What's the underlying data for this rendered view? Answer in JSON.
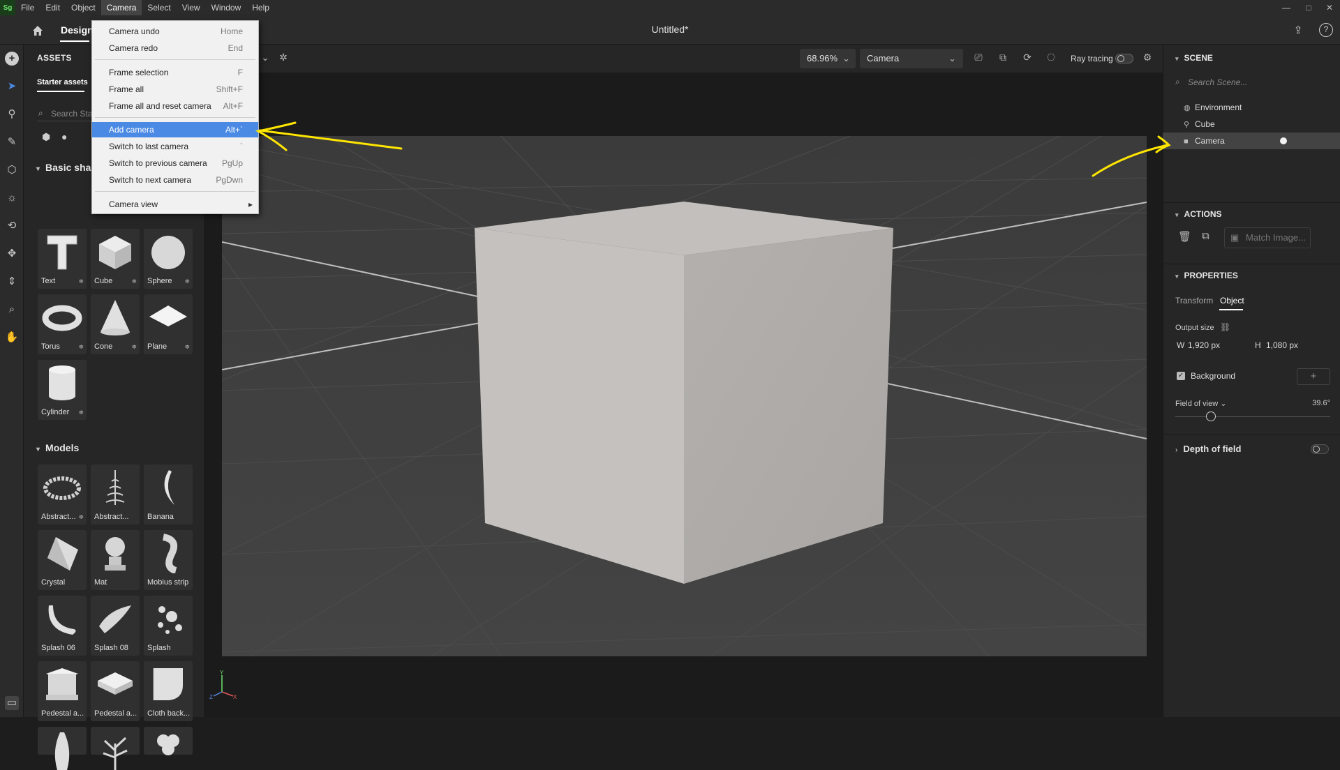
{
  "menubar": {
    "logo": "Sg",
    "items": [
      "File",
      "Edit",
      "Object",
      "Camera",
      "Select",
      "View",
      "Window",
      "Help"
    ],
    "active": "Camera"
  },
  "header": {
    "tab_design": "Design",
    "doc_title": "Untitled*"
  },
  "assets": {
    "title": "ASSETS",
    "tab": "Starter assets",
    "search_placeholder": "Search Starter assets",
    "sections": {
      "basic": "Basic shapes",
      "models": "Models"
    },
    "basic_shapes": [
      "Text",
      "Cube",
      "Sphere",
      "Torus",
      "Cone",
      "Plane",
      "Cylinder"
    ],
    "models": [
      "Abstract...",
      "Abstract...",
      "Banana",
      "Crystal",
      "Mat",
      "Mobius strip",
      "Splash 06",
      "Splash 08",
      "Splash",
      "Pedestal a...",
      "Pedestal a...",
      "Cloth back..."
    ]
  },
  "viewport_toolbar": {
    "zoom": "68.96%",
    "camera_select": "Camera",
    "ray_tracing_label": "Ray tracing",
    "size_hint": "px"
  },
  "camera_menu": {
    "groups": [
      [
        {
          "label": "Camera undo",
          "shortcut": "Home"
        },
        {
          "label": "Camera redo",
          "shortcut": "End"
        }
      ],
      [
        {
          "label": "Frame selection",
          "shortcut": "F"
        },
        {
          "label": "Frame all",
          "shortcut": "Shift+F"
        },
        {
          "label": "Frame all and reset camera",
          "shortcut": "Alt+F"
        }
      ],
      [
        {
          "label": "Add camera",
          "shortcut": "Alt+`",
          "highlighted": true
        },
        {
          "label": "Switch to last camera",
          "shortcut": "`"
        },
        {
          "label": "Switch to previous camera",
          "shortcut": "PgUp"
        },
        {
          "label": "Switch to next camera",
          "shortcut": "PgDwn"
        }
      ],
      [
        {
          "label": "Camera view",
          "shortcut": "▸"
        }
      ]
    ]
  },
  "scene": {
    "title": "SCENE",
    "search_placeholder": "Search Scene...",
    "items": [
      "Environment",
      "Cube",
      "Camera"
    ],
    "selected": "Camera"
  },
  "actions": {
    "title": "ACTIONS",
    "match_image": "Match Image..."
  },
  "properties": {
    "title": "PROPERTIES",
    "tabs": [
      "Transform",
      "Object"
    ],
    "active_tab": "Object",
    "output_size_label": "Output size",
    "w_label": "W",
    "w_value": "1,920 px",
    "h_label": "H",
    "h_value": "1,080 px",
    "background_label": "Background",
    "background_checked": true,
    "fov_label": "Field of view",
    "fov_value": "39.6°",
    "dof_label": "Depth of field"
  },
  "colors": {
    "accent": "#4a8ae4",
    "annotation": "#ffe600"
  }
}
